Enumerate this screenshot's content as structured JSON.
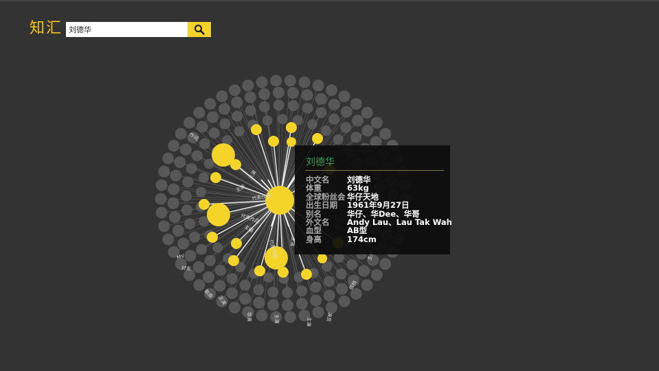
{
  "app": {
    "logo": "知汇"
  },
  "search": {
    "value": "刘德华",
    "button_icon": "search-icon"
  },
  "colors": {
    "background": "#333333",
    "accent": "#f5d42a",
    "node_gray": "#5e5e5e",
    "tooltip_title": "#3e9c5a"
  },
  "graph": {
    "center": "刘德华",
    "labels": [
      "主演",
      "主演",
      "代表作品",
      "代表作品",
      "主唱",
      "代表作品",
      "主演",
      "作词",
      "MV",
      "好友",
      "歌曲",
      "主演",
      "导演",
      "主演",
      "主演",
      "演员",
      "搭档",
      "主演"
    ]
  },
  "tooltip": {
    "title": "刘德华",
    "rows": [
      {
        "key": "中文名",
        "value": "刘德华"
      },
      {
        "key": "体重",
        "value": "63kg"
      },
      {
        "key": "全球粉丝会",
        "value": "华仔天地"
      },
      {
        "key": "出生日期",
        "value": "1961年9月27日"
      },
      {
        "key": "别名",
        "value": "华仔、华Dee、华哥"
      },
      {
        "key": "外文名",
        "value": "Andy Lau、Lau Tak Wah"
      },
      {
        "key": "血型",
        "value": "AB型"
      },
      {
        "key": "身高",
        "value": "174cm"
      }
    ]
  }
}
